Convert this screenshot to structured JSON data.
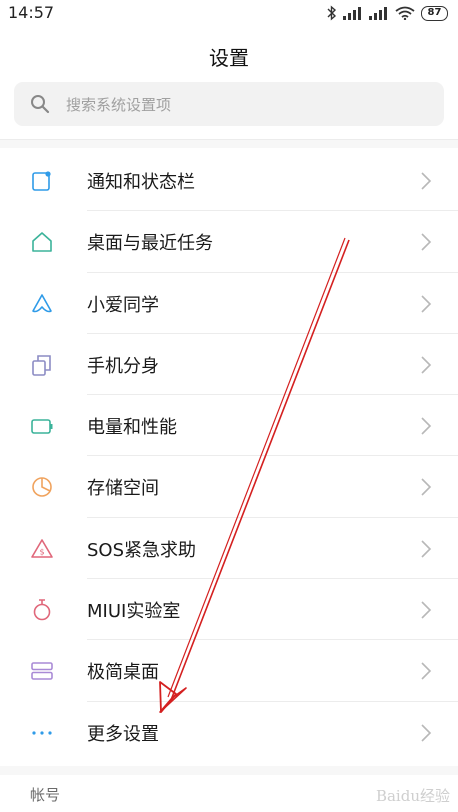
{
  "status_bar": {
    "time": "14:57",
    "battery": "87"
  },
  "header": {
    "title": "设置"
  },
  "search": {
    "placeholder": "搜索系统设置项"
  },
  "settings": [
    {
      "label": "通知和状态栏",
      "icon": "notification-icon",
      "color": "#2f9be8"
    },
    {
      "label": "桌面与最近任务",
      "icon": "home-icon",
      "color": "#3bb39a"
    },
    {
      "label": "小爱同学",
      "icon": "xiaoai-icon",
      "color": "#2f9be8"
    },
    {
      "label": "手机分身",
      "icon": "clone-icon",
      "color": "#8c8cc4"
    },
    {
      "label": "电量和性能",
      "icon": "battery-icon",
      "color": "#3bb39a"
    },
    {
      "label": "存储空间",
      "icon": "storage-icon",
      "color": "#f0a35e"
    },
    {
      "label": "SOS紧急求助",
      "icon": "sos-icon",
      "color": "#e0677a"
    },
    {
      "label": "MIUI实验室",
      "icon": "lab-icon",
      "color": "#e0677a"
    },
    {
      "label": "极简桌面",
      "icon": "minimal-desktop-icon",
      "color": "#a98ad6"
    },
    {
      "label": "更多设置",
      "icon": "more-icon",
      "color": "#2f9be8"
    }
  ],
  "section": {
    "account_header": "帐号"
  },
  "watermark": {
    "text": "Baidu经验"
  },
  "colors": {
    "arrow": "#d42020",
    "chevron": "#b8b8b8"
  }
}
